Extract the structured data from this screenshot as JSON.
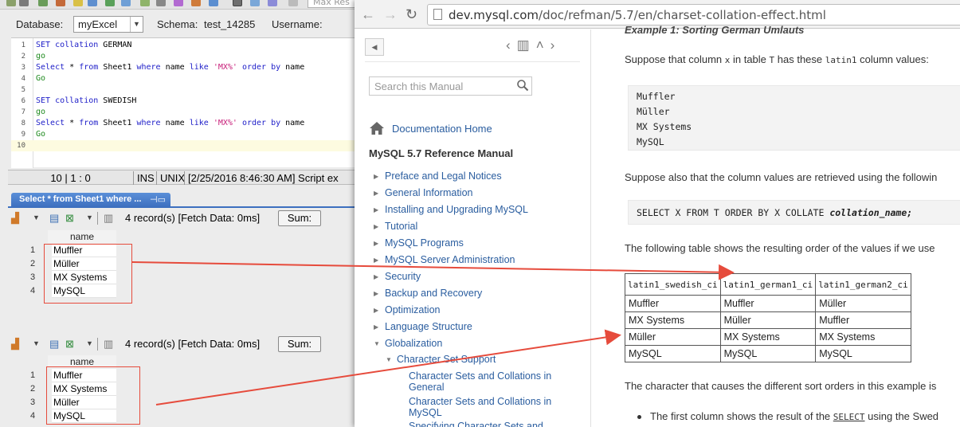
{
  "sql_client": {
    "top_toolbar": {
      "max_results_placeholder": "Max Res"
    },
    "database_label": "Database:",
    "database_value": "myExcel",
    "schema_label": "Schema:",
    "schema_value": "test_14285",
    "username_label": "Username:",
    "editor_lines": [
      {
        "n": "1",
        "parts": [
          [
            "kw",
            "SET collation "
          ],
          [
            "",
            "GERMAN"
          ]
        ]
      },
      {
        "n": "2",
        "parts": [
          [
            "kw2",
            "go"
          ]
        ]
      },
      {
        "n": "3",
        "parts": [
          [
            "kw",
            "Select "
          ],
          [
            "",
            "* "
          ],
          [
            "kw",
            "from "
          ],
          [
            "",
            "Sheet1 "
          ],
          [
            "kw",
            "where "
          ],
          [
            "",
            "name "
          ],
          [
            "kw",
            "like "
          ],
          [
            "str",
            "'MX%'"
          ],
          [
            "kw",
            " order by "
          ],
          [
            "",
            "name"
          ]
        ]
      },
      {
        "n": "4",
        "parts": [
          [
            "kw2",
            "Go"
          ]
        ]
      },
      {
        "n": "5",
        "parts": []
      },
      {
        "n": "6",
        "parts": [
          [
            "kw",
            "SET collation "
          ],
          [
            "",
            "SWEDISH"
          ]
        ]
      },
      {
        "n": "7",
        "parts": [
          [
            "kw2",
            "go"
          ]
        ]
      },
      {
        "n": "8",
        "parts": [
          [
            "kw",
            "Select "
          ],
          [
            "",
            "* "
          ],
          [
            "kw",
            "from "
          ],
          [
            "",
            "Sheet1 "
          ],
          [
            "kw",
            "where "
          ],
          [
            "",
            "name "
          ],
          [
            "kw",
            "like "
          ],
          [
            "str",
            "'MX%'"
          ],
          [
            "kw",
            " order by "
          ],
          [
            "",
            "name"
          ]
        ]
      },
      {
        "n": "9",
        "parts": [
          [
            "kw2",
            "Go"
          ]
        ]
      },
      {
        "n": "10",
        "parts": []
      }
    ],
    "status": {
      "position": "10 | 1 : 0",
      "mode_ins": "INS",
      "mode_unix": "UNIX",
      "message": "[2/25/2016 8:46:30 AM] Script ex"
    },
    "result_tab_label": "Select * from Sheet1 where ...",
    "result_sets": [
      {
        "records_text": "4 record(s) [Fetch Data: 0ms]",
        "sum_label": "Sum:",
        "column": "name",
        "rows": [
          {
            "n": "1",
            "value": "Muffler"
          },
          {
            "n": "2",
            "value": "Müller"
          },
          {
            "n": "3",
            "value": "MX Systems"
          },
          {
            "n": "4",
            "value": "MySQL"
          }
        ]
      },
      {
        "records_text": "4 record(s) [Fetch Data: 0ms]",
        "sum_label": "Sum:",
        "column": "name",
        "rows": [
          {
            "n": "1",
            "value": "Muffler"
          },
          {
            "n": "2",
            "value": "MX Systems"
          },
          {
            "n": "3",
            "value": "Müller"
          },
          {
            "n": "4",
            "value": "MySQL"
          }
        ]
      }
    ]
  },
  "browser": {
    "url_host": "dev.mysql.com",
    "url_path": "/doc/refman/5.7/en/charset-collation-effect.html",
    "search_placeholder": "Search this Manual",
    "home_link": "Documentation Home",
    "manual_title": "MySQL 5.7 Reference Manual",
    "toc": [
      {
        "label": "Preface and Legal Notices",
        "expanded": false
      },
      {
        "label": "General Information",
        "expanded": false
      },
      {
        "label": "Installing and Upgrading MySQL",
        "expanded": false
      },
      {
        "label": "Tutorial",
        "expanded": false
      },
      {
        "label": "MySQL Programs",
        "expanded": false
      },
      {
        "label": "MySQL Server Administration",
        "expanded": false
      },
      {
        "label": "Security",
        "expanded": false
      },
      {
        "label": "Backup and Recovery",
        "expanded": false
      },
      {
        "label": "Optimization",
        "expanded": false
      },
      {
        "label": "Language Structure",
        "expanded": false
      },
      {
        "label": "Globalization",
        "expanded": true
      }
    ],
    "toc_sub": "Character Set Support",
    "toc_subsub": [
      {
        "line1": "Character Sets and Collations in",
        "line2": "General"
      },
      {
        "line1": "Character Sets and Collations in",
        "line2": "MySQL"
      },
      {
        "line1": "Specifying Character Sets and",
        "line2": ""
      }
    ],
    "content": {
      "example_heading": "Example 1: Sorting German Umlauts",
      "para1_pre": "Suppose that column ",
      "para1_col": "x",
      "para1_mid": " in table ",
      "para1_tbl": "T",
      "para1_mid2": " has these ",
      "para1_cs": "latin1",
      "para1_post": " column values:",
      "values_block": [
        "Muffler",
        "Müller",
        "MX Systems",
        "MySQL"
      ],
      "para2": "Suppose also that the column values are retrieved using the followin",
      "query_plain": "SELECT X FROM T ORDER BY X COLLATE ",
      "query_param": "collation_name;",
      "para3": "The following table shows the resulting order of the values if we use",
      "table_headers": [
        "latin1_swedish_ci",
        "latin1_german1_ci",
        "latin1_german2_ci"
      ],
      "table_rows": [
        [
          "Muffler",
          "Muffler",
          "Müller"
        ],
        [
          "MX Systems",
          "Müller",
          "Muffler"
        ],
        [
          "Müller",
          "MX Systems",
          "MX Systems"
        ],
        [
          "MySQL",
          "MySQL",
          "MySQL"
        ]
      ],
      "para4": "The character that causes the different sort orders in this example is",
      "bullet_pre": "The first column shows the result of the ",
      "bullet_kw": "SELECT",
      "bullet_post": " using the Swed"
    }
  },
  "colors": {
    "annotation_red": "#e64b3c",
    "link_blue": "#2a5d9f",
    "keyword_blue": "#1d1dc8",
    "keyword_green": "#1f8a1f",
    "string_magenta": "#c8207a",
    "tab_blue": "#3d6fbf"
  }
}
